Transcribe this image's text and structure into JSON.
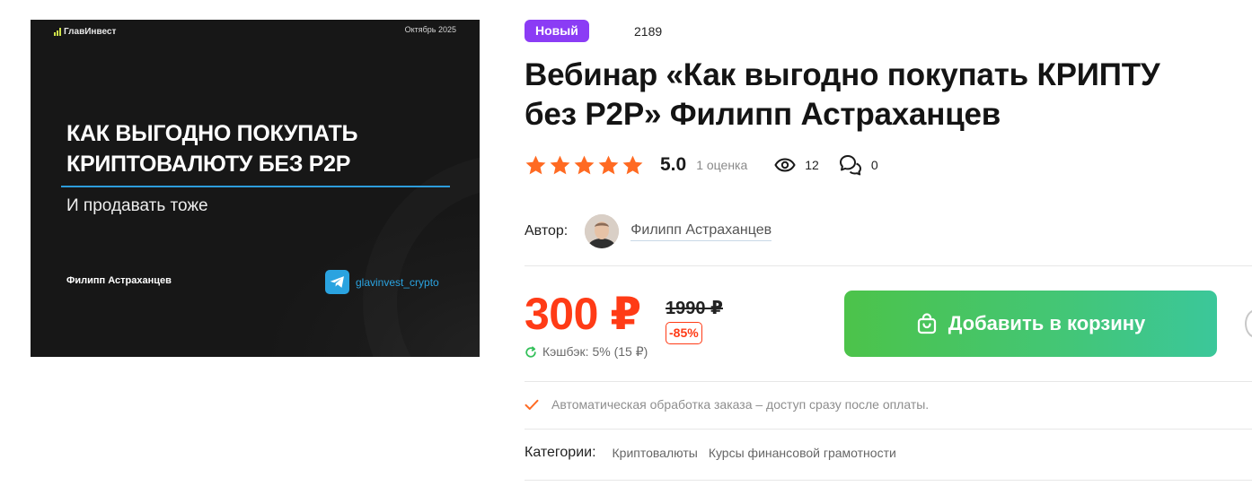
{
  "cover": {
    "brand": "ГлавИнвест",
    "date": "Октябрь 2025",
    "title_line1": "КАК ВЫГОДНО ПОКУПАТЬ",
    "title_line2": "КРИПТОВАЛЮТУ БЕЗ P2P",
    "subtitle": "И продавать тоже",
    "author": "Филипп Астраханцев",
    "telegram": "glavinvest_crypto"
  },
  "product": {
    "badge": "Новый",
    "id": "2189",
    "title": "Вебинар «Как выгодно покупать КРИПТУ без P2P» Филипп Астраханцев"
  },
  "rating": {
    "stars": 5,
    "score": "5.0",
    "count_text": "1 оценка",
    "views": "12",
    "comments": "0"
  },
  "author": {
    "label": "Автор:",
    "name": "Филипп Астраханцев"
  },
  "price": {
    "current": "300 ₽",
    "old": "1990 ₽",
    "discount": "-85%",
    "cashback": "Кэшбэк: 5% (15 ₽)"
  },
  "cart": {
    "label": "Добавить в корзину"
  },
  "notice": "Автоматическая обработка заказа – доступ сразу после оплаты.",
  "categories": {
    "label": "Категории:",
    "items": [
      "Криптовалюты",
      "Курсы финансовой грамотности"
    ]
  },
  "colors": {
    "accent": "#ff3b16",
    "badge": "#8b3cf5",
    "star": "#ff6a22",
    "cart_start": "#4cc34a",
    "cart_end": "#3bc79a"
  }
}
